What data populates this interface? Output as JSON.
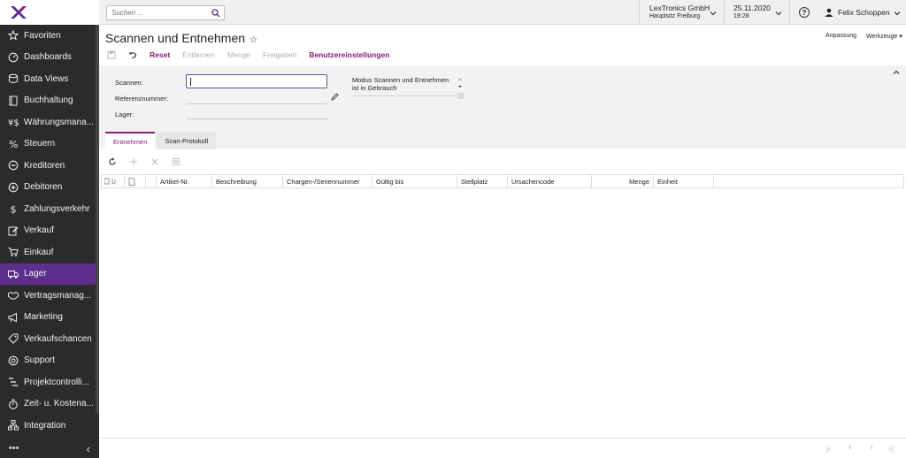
{
  "colors": {
    "sidebar_bg": "#2b2b2b",
    "active_item": "#5d2e8c",
    "accent": "#8a1a7c",
    "focus_border": "#6a4c93"
  },
  "sidebar": {
    "items": [
      {
        "label": "Favoriten",
        "icon": "star-icon"
      },
      {
        "label": "Dashboards",
        "icon": "gauge-icon"
      },
      {
        "label": "Data Views",
        "icon": "database-icon"
      },
      {
        "label": "Buchhaltung",
        "icon": "book-icon"
      },
      {
        "label": "Währungsmana...",
        "icon": "currency-icon"
      },
      {
        "label": "Steuern",
        "icon": "percent-icon"
      },
      {
        "label": "Kreditoren",
        "icon": "minus-circle-icon"
      },
      {
        "label": "Debitoren",
        "icon": "plus-circle-icon"
      },
      {
        "label": "Zahlungsverkehr",
        "icon": "dollar-icon"
      },
      {
        "label": "Verkauf",
        "icon": "edit-icon"
      },
      {
        "label": "Einkauf",
        "icon": "cart-icon"
      },
      {
        "label": "Lager",
        "icon": "truck-icon",
        "active": true
      },
      {
        "label": "Vertragsmanag...",
        "icon": "handshake-icon"
      },
      {
        "label": "Marketing",
        "icon": "megaphone-icon"
      },
      {
        "label": "Verkaufschancen",
        "icon": "tag-icon"
      },
      {
        "label": "Support",
        "icon": "lifebuoy-icon"
      },
      {
        "label": "Projektcontrolli...",
        "icon": "tasks-icon"
      },
      {
        "label": "Zeit- u. Kostena...",
        "icon": "stopwatch-icon"
      },
      {
        "label": "Integration",
        "icon": "sitemap-icon"
      }
    ],
    "more": "•••",
    "collapse": "‹"
  },
  "topbar": {
    "search_placeholder": "Suchen ...",
    "company": "LexTronics GmbH",
    "branch": "Hauptsitz Freiburg",
    "date": "25.11.2020",
    "time": "19:28",
    "help": "?",
    "user": "Felix Schoppen"
  },
  "page": {
    "title": "Scannen und Entnehmen",
    "star": "☆",
    "customize": "Anpassung",
    "tools": "Werkzeuge ▾",
    "actions": {
      "reset": "Reset",
      "remove": "Entfernen",
      "quantity": "Menge",
      "release": "Freigeben",
      "settings": "Benutzereinstellungen"
    }
  },
  "form": {
    "scan_label": "Scannen:",
    "scan_value": "",
    "ref_label": "Referenznummer:",
    "store_label": "Lager:",
    "mode_text": "Modus Scannen und Entnehmen ist in Gebrauch"
  },
  "tabs": [
    "Entnehmen",
    "Scan-Protokoll"
  ],
  "grid": {
    "columns": [
      "Artikel-Nr.",
      "Beschreibung",
      "Chargen-/Seriennummer",
      "Gültig bis",
      "Stellplatz",
      "Ursachencode",
      "Menge",
      "Einheit"
    ]
  },
  "pager": {
    "first": "|‹",
    "prev": "‹",
    "next": "›",
    "last": "›|"
  }
}
